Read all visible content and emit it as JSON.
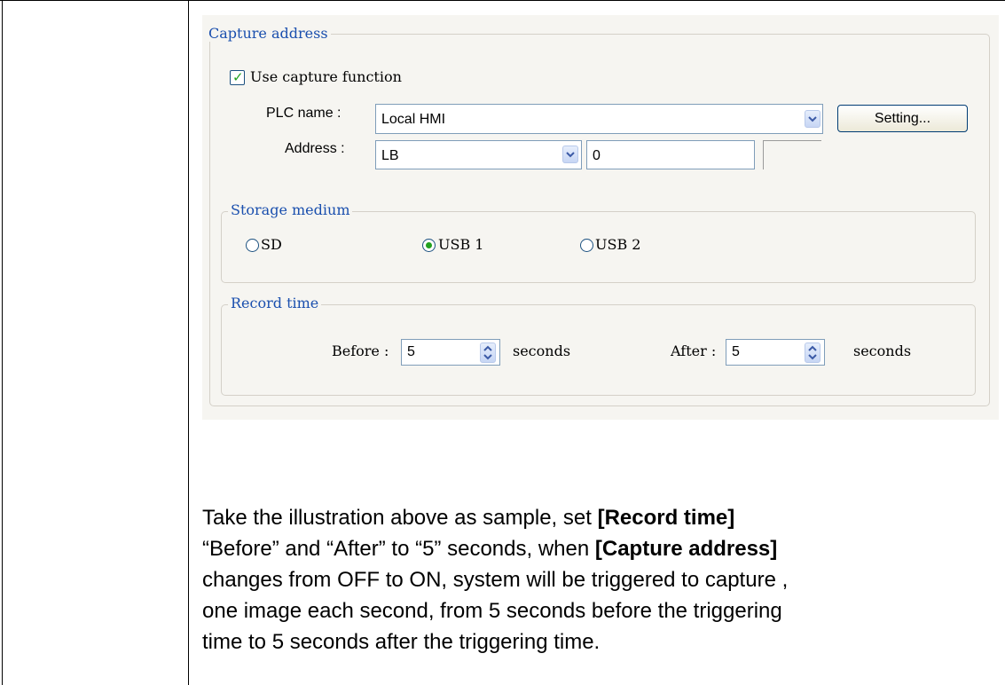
{
  "dialog": {
    "capture_group_label": "Capture address",
    "use_capture_label": "Use capture function",
    "use_capture_checked": true,
    "plc_name_label": "PLC name :",
    "plc_name_value": "Local HMI",
    "setting_button": "Setting...",
    "address_label": "Address :",
    "address_device": "LB",
    "address_value": "0",
    "storage_group_label": "Storage medium",
    "storage_options": [
      {
        "label": "SD",
        "selected": false
      },
      {
        "label": "USB 1",
        "selected": true
      },
      {
        "label": "USB 2",
        "selected": false
      }
    ],
    "record_group_label": "Record time",
    "before_label": "Before :",
    "before_value": "5",
    "before_unit": "seconds",
    "after_label": "After :",
    "after_value": "5",
    "after_unit": "seconds"
  },
  "description": {
    "line1_pre": "Take the illustration above as sample, set ",
    "line1_bold": "[Record time]",
    "line2_pre": "“Before” and “After” to “5” seconds, when ",
    "line2_bold": "[Capture address]",
    "line3": "changes from OFF to ON, system will be triggered to capture ,",
    "line4": "one image each second, from 5 seconds before the triggering",
    "line5": "time to 5 seconds after the triggering time."
  },
  "colors": {
    "legend_text": "#1a4fae",
    "check_mark": "#22a11e",
    "panel_bg": "#f6f5f1"
  }
}
